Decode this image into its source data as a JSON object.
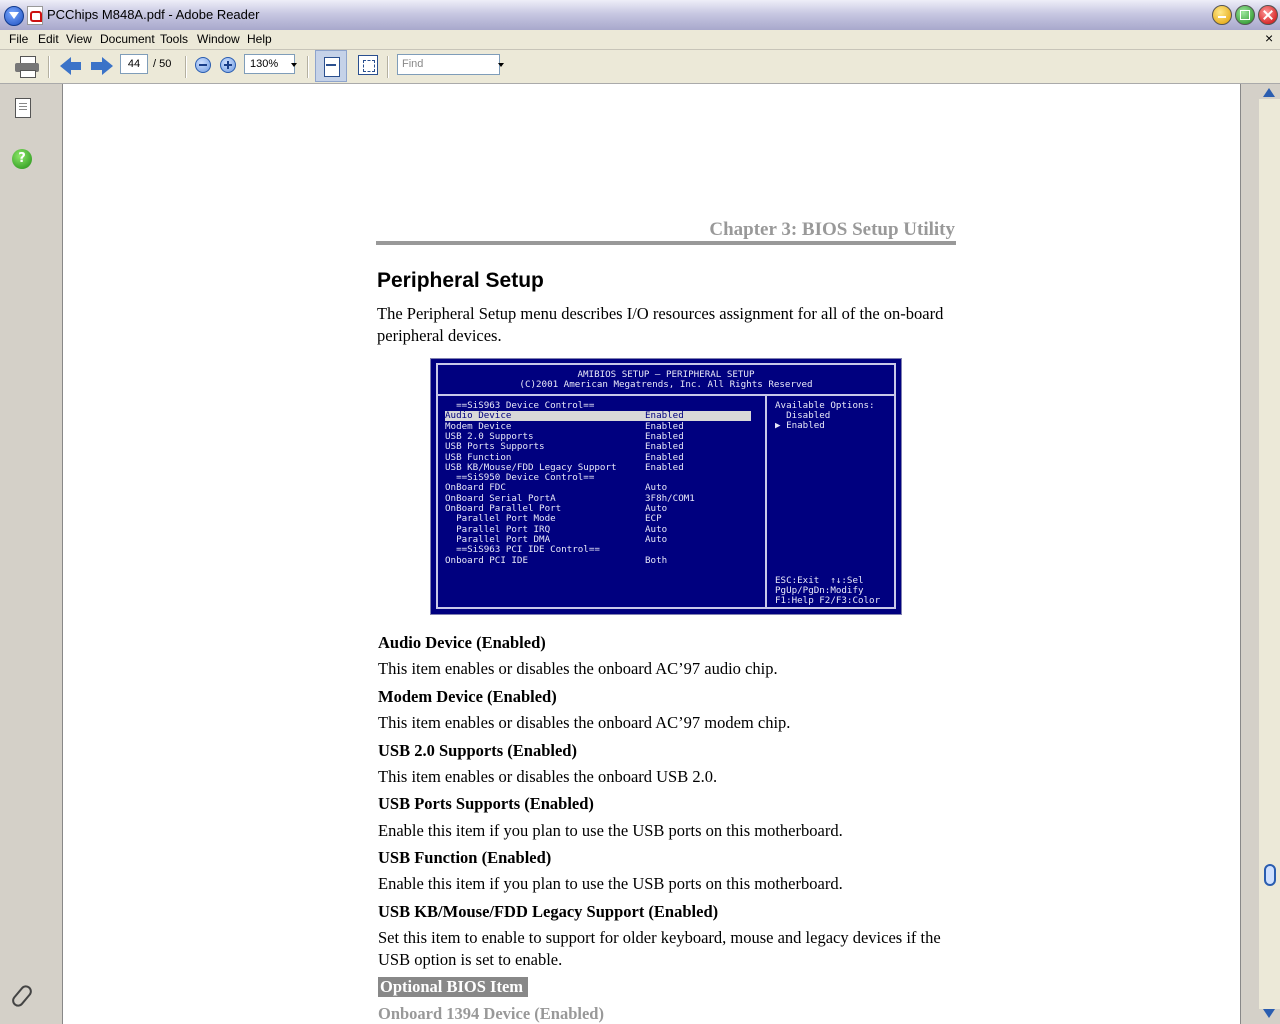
{
  "window": {
    "title": "PCChips M848A.pdf - Adobe Reader"
  },
  "menu": [
    "File",
    "Edit",
    "View",
    "Document",
    "Tools",
    "Window",
    "Help"
  ],
  "toolbar": {
    "page_current": "44",
    "page_total": "/ 50",
    "zoom": "130%",
    "find_placeholder": "Find"
  },
  "document": {
    "chapter_header": "Chapter 3: BIOS Setup Utility",
    "section_title": "Peripheral Setup",
    "intro": "The Peripheral Setup menu describes I/O resources assignment for all of the on-board peripheral devices.",
    "bios_screen": {
      "title_line1": "AMIBIOS SETUP – PERIPHERAL SETUP",
      "title_line2": "(C)2001 American Megatrends, Inc. All Rights Reserved",
      "rows": [
        {
          "label": "  ==SiS963 Device Control==",
          "value": ""
        },
        {
          "label": "Audio Device",
          "value": "Enabled"
        },
        {
          "label": "Modem Device",
          "value": "Enabled"
        },
        {
          "label": "USB 2.0 Supports",
          "value": "Enabled"
        },
        {
          "label": "USB Ports Supports",
          "value": "Enabled"
        },
        {
          "label": "USB Function",
          "value": "Enabled"
        },
        {
          "label": "USB KB/Mouse/FDD Legacy Support",
          "value": "Enabled"
        },
        {
          "label": "  ==SiS950 Device Control==",
          "value": ""
        },
        {
          "label": "OnBoard FDC",
          "value": "Auto"
        },
        {
          "label": "OnBoard Serial PortA",
          "value": "3F8h/COM1"
        },
        {
          "label": "OnBoard Parallel Port",
          "value": "Auto"
        },
        {
          "label": "  Parallel Port Mode",
          "value": "ECP"
        },
        {
          "label": "  Parallel Port IRQ",
          "value": "Auto"
        },
        {
          "label": "  Parallel Port DMA",
          "value": "Auto"
        },
        {
          "label": "  ==SiS963 PCI IDE Control==",
          "value": ""
        },
        {
          "label": "Onboard PCI IDE",
          "value": "Both"
        }
      ],
      "side_options_title": "Available Options:",
      "side_options": [
        "  Disabled",
        "▶ Enabled"
      ],
      "help_lines": [
        "ESC:Exit  ↑↓:Sel",
        "PgUp/PgDn:Modify",
        "F1:Help F2/F3:Color"
      ]
    },
    "items": [
      {
        "heading": "Audio Device (Enabled)",
        "desc": "This item enables or disables the onboard AC’97 audio chip."
      },
      {
        "heading": "Modem Device (Enabled)",
        "desc": "This item enables or disables the onboard AC’97 modem chip."
      },
      {
        "heading": "USB 2.0 Supports (Enabled)",
        "desc": "This item enables or disables the onboard USB 2.0."
      },
      {
        "heading": "USB Ports Supports (Enabled)",
        "desc": "Enable this item if you plan to use the USB ports on this motherboard."
      },
      {
        "heading": "USB Function (Enabled)",
        "desc": "Enable this item if you plan to use the USB ports on this motherboard."
      },
      {
        "heading": "USB KB/Mouse/FDD Legacy Support (Enabled)",
        "desc": "Set this item to enable to support for older keyboard, mouse and legacy devices if the USB option is set to enable."
      }
    ],
    "optional_badge": "Optional BIOS Item",
    "next_item_heading": "Onboard 1394 Device (Enabled)"
  }
}
